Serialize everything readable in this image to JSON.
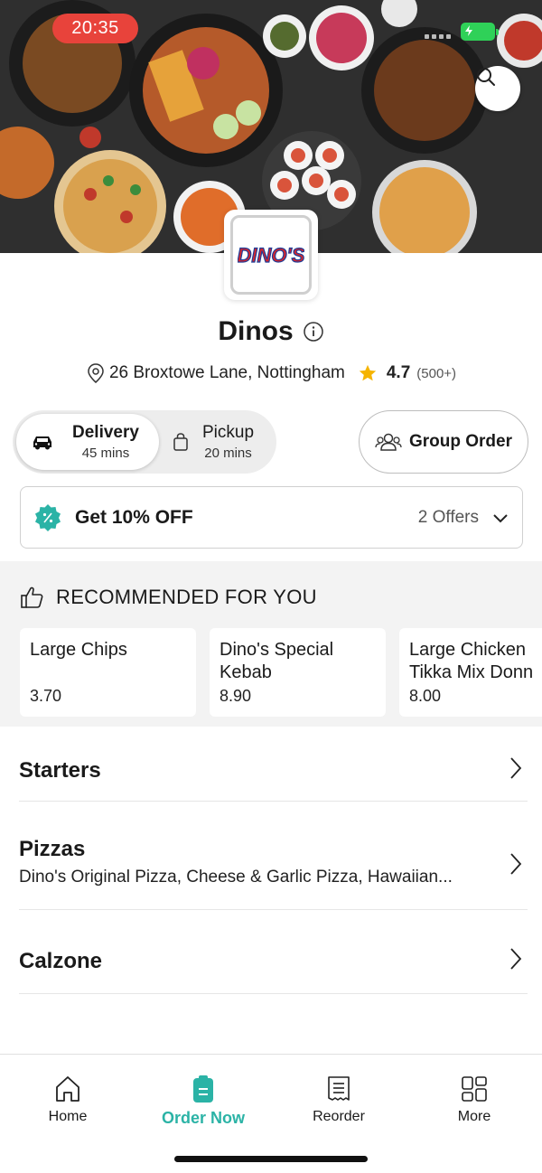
{
  "status_bar": {
    "time": "20:35"
  },
  "store": {
    "name": "Dinos",
    "logo_text": "DINO'S",
    "address": "26 Broxtowe Lane, Nottingham",
    "rating": "4.7",
    "reviews": "(500+)"
  },
  "modes": {
    "delivery": {
      "label": "Delivery",
      "time": "45 mins"
    },
    "pickup": {
      "label": "Pickup",
      "time": "20 mins"
    },
    "selected": "delivery"
  },
  "group_order_label": "Group Order",
  "offers": {
    "title": "Get 10% OFF",
    "count": "2 Offers"
  },
  "recommended": {
    "title": "RECOMMENDED FOR YOU",
    "items": [
      {
        "name_line1": "Large Chips",
        "name_line2": "",
        "price": "3.70"
      },
      {
        "name_line1": "Dino's Special",
        "name_line2": "Kebab",
        "price": "8.90"
      },
      {
        "name_line1": "Large Chicken",
        "name_line2": "Tikka Mix Donn",
        "price": "8.00"
      }
    ]
  },
  "categories": [
    {
      "name": "Starters",
      "description": ""
    },
    {
      "name": "Pizzas",
      "description": "Dino's Original Pizza, Cheese & Garlic Pizza, Hawaiian..."
    },
    {
      "name": "Calzone",
      "description": ""
    }
  ],
  "tabbar": {
    "items": [
      {
        "label": "Home",
        "icon": "home-icon"
      },
      {
        "label": "Order Now",
        "icon": "order-icon"
      },
      {
        "label": "Reorder",
        "icon": "receipt-icon"
      },
      {
        "label": "More",
        "icon": "grid-icon"
      }
    ],
    "active": "Order Now"
  },
  "colors": {
    "accent": "#2bb3a6",
    "star": "#f5b400",
    "time_pill": "#e8433b",
    "battery": "#2fd158",
    "logo_red": "#d6242b",
    "logo_blue": "#1f3f9a"
  }
}
